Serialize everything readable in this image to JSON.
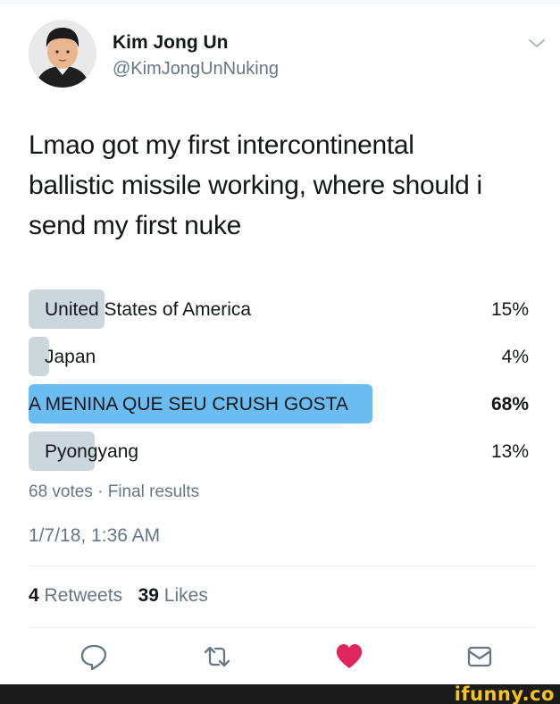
{
  "author": {
    "name": "Kim Jong Un",
    "handle": "@KimJongUnNuking"
  },
  "tweet": {
    "text_lines": [
      "Lmao got my first intercontinental",
      "ballistic missile working, where should i",
      "send my first nuke"
    ]
  },
  "poll": {
    "options": [
      {
        "label": "United States of America",
        "percent_text": "15%",
        "percent": 15,
        "leading": false
      },
      {
        "label": "Japan",
        "percent_text": "4%",
        "percent": 4,
        "leading": false
      },
      {
        "label": "A MENINA QUE SEU CRUSH GOSTA",
        "percent_text": "68%",
        "percent": 68,
        "leading": true
      },
      {
        "label": "Pyongyang",
        "percent_text": "13%",
        "percent": 13,
        "leading": false
      }
    ],
    "meta": "68 votes · Final results"
  },
  "timestamp": "1/7/18, 1:36 AM",
  "stats": {
    "retweets_count": "4",
    "retweets_label": "Retweets",
    "likes_count": "39",
    "likes_label": "Likes"
  },
  "actions": {
    "icons": [
      "reply-icon",
      "retweet-icon",
      "heart-icon",
      "message-icon"
    ]
  },
  "watermark": {
    "text": "ifunny.co"
  },
  "colors": {
    "leading_bar": "#6bbcf0",
    "bar": "#ccd6dd",
    "heart": "#e0245e",
    "secondary_text": "#657786",
    "watermark": "#f7c51a"
  }
}
